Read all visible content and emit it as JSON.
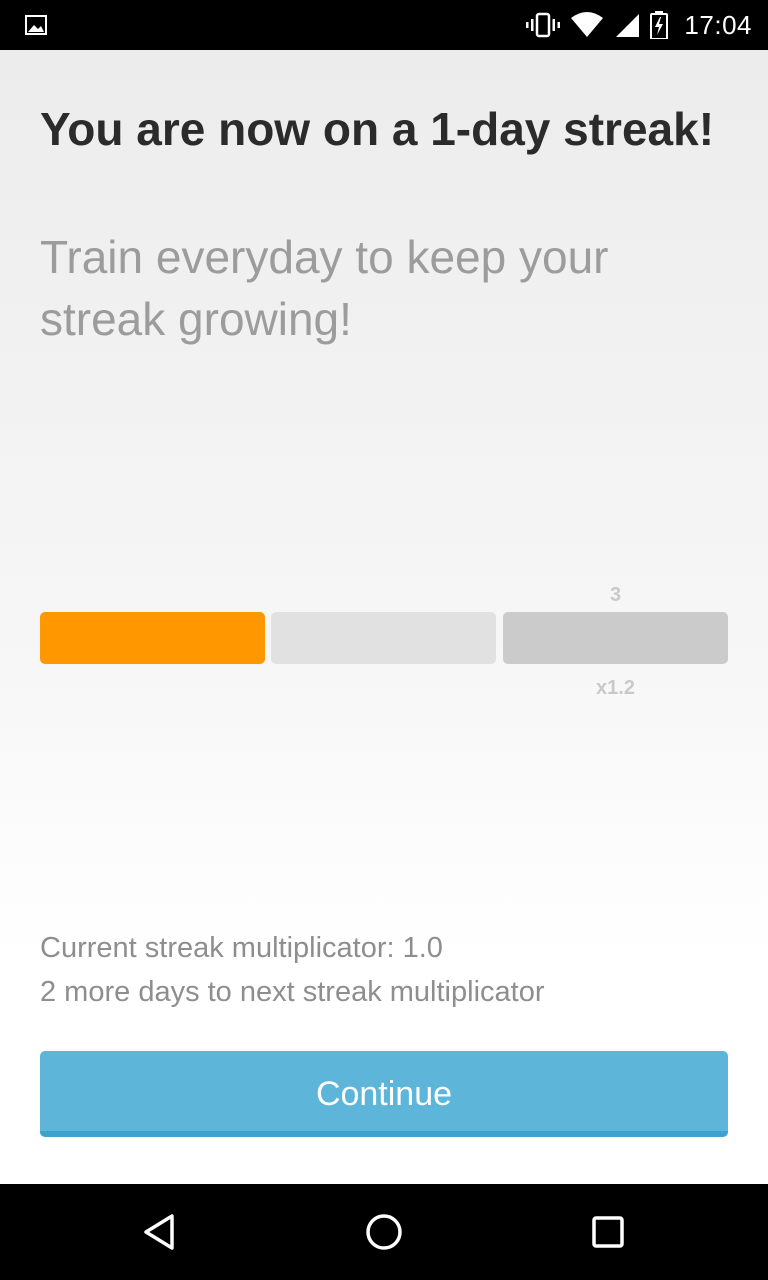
{
  "status_bar": {
    "time": "17:04",
    "icons": [
      "gallery-notification-icon",
      "vibrate-icon",
      "wifi-icon",
      "cellular-signal-icon",
      "battery-charging-icon"
    ]
  },
  "streak": {
    "title": "You are now on a 1-day streak!",
    "subtitle": "Train everyday to keep your streak growing!",
    "current_day": 1,
    "segments": 3,
    "milestone_day": "3",
    "milestone_multiplier": "x1.2",
    "info_line_1": "Current streak multiplicator: 1.0",
    "info_line_2": "2 more days to next streak multiplicator",
    "continue_label": "Continue"
  },
  "colors": {
    "accent_orange": "#ff9800",
    "button_blue": "#5db6d9",
    "segment_empty": "#e1e1e1",
    "segment_milestone": "#cbcbcb"
  },
  "nav_bar": {
    "icons": [
      "back-icon",
      "home-icon",
      "recents-icon"
    ]
  }
}
